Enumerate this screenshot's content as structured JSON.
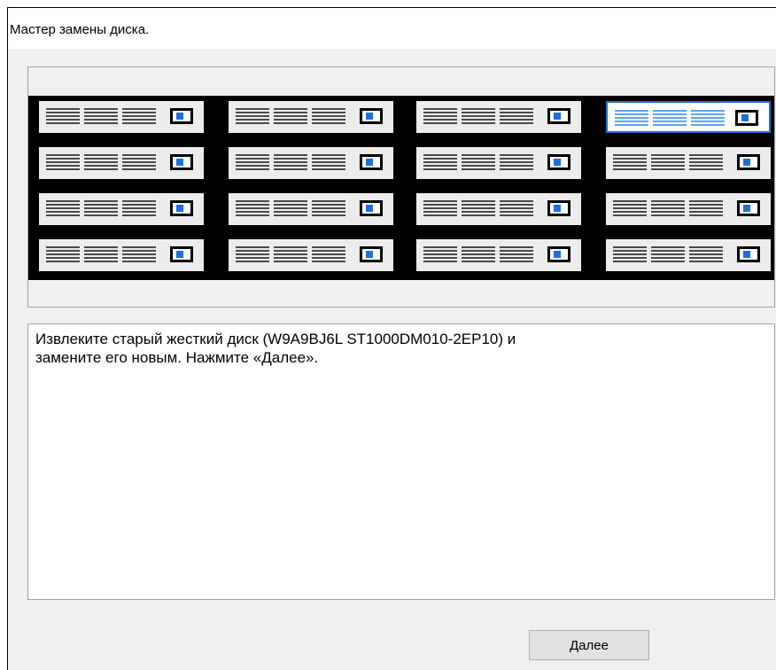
{
  "window": {
    "title": "Мастер замены диска."
  },
  "drive_bays": {
    "rows": 4,
    "columns": 4,
    "selected_row": 0,
    "selected_column": 3,
    "selected_color": "#1e6fd9",
    "led_color": "#1e6fd9",
    "frame_color": "#000000",
    "icons": {
      "drive": "hard-drive-bay-icon",
      "indicator": "drive-led-icon"
    }
  },
  "message": {
    "text": "Извлеките старый жесткий диск (W9A9BJ6L ST1000DM010-2EP10) и\nзамените его новым. Нажмите «Далее»."
  },
  "buttons": {
    "next_label": "Далее"
  }
}
